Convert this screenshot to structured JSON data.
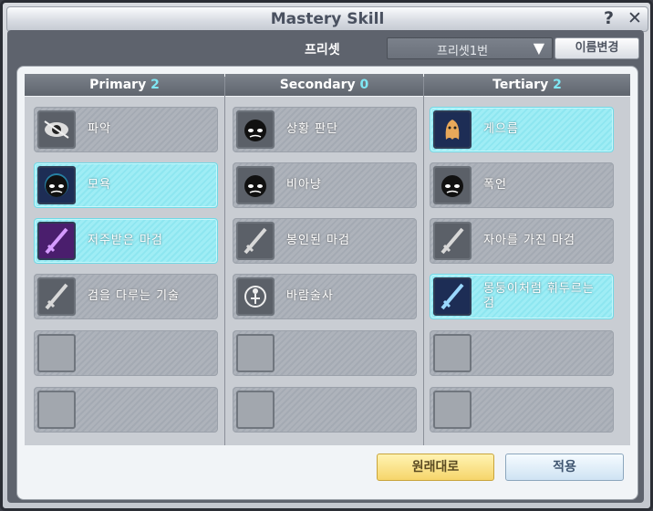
{
  "window": {
    "title": "Mastery Skill",
    "help_label": "?",
    "close_label": "✕"
  },
  "preset": {
    "label": "프리셋",
    "selected": "프리셋1번",
    "rename_label": "이름변경"
  },
  "columns": [
    {
      "title": "Primary",
      "count": "2",
      "slots": [
        {
          "name": "파악",
          "icon": "eye-icon",
          "active": false
        },
        {
          "name": "모욕",
          "icon": "angry-face-icon",
          "active": true
        },
        {
          "name": "저주받은 마검",
          "icon": "cursed-sword-icon",
          "active": true
        },
        {
          "name": "검을 다루는 기술",
          "icon": "sword-technique-icon",
          "active": false
        },
        {
          "name": "",
          "icon": "empty-slot-icon",
          "active": false
        },
        {
          "name": "",
          "icon": "empty-slot-icon",
          "active": false
        }
      ]
    },
    {
      "title": "Secondary",
      "count": "0",
      "slots": [
        {
          "name": "상황 판단",
          "icon": "situation-face-icon",
          "active": false
        },
        {
          "name": "비아냥",
          "icon": "sneer-face-icon",
          "active": false
        },
        {
          "name": "봉인된 마검",
          "icon": "sealed-sword-icon",
          "active": false
        },
        {
          "name": "바람술사",
          "icon": "wind-mage-icon",
          "active": false
        },
        {
          "name": "",
          "icon": "empty-slot-icon",
          "active": false
        },
        {
          "name": "",
          "icon": "empty-slot-icon",
          "active": false
        }
      ]
    },
    {
      "title": "Tertiary",
      "count": "2",
      "slots": [
        {
          "name": "게으름",
          "icon": "lazy-ghost-icon",
          "active": true
        },
        {
          "name": "폭언",
          "icon": "rant-face-icon",
          "active": false
        },
        {
          "name": "자아를 가진 마검",
          "icon": "ego-sword-icon",
          "active": false
        },
        {
          "name": "몽둥이처럼 휘두르는 검",
          "icon": "club-sword-icon",
          "active": true
        },
        {
          "name": "",
          "icon": "empty-slot-icon",
          "active": false
        },
        {
          "name": "",
          "icon": "empty-slot-icon",
          "active": false
        }
      ]
    }
  ],
  "footer": {
    "reset_label": "원래대로",
    "apply_label": "적용"
  }
}
